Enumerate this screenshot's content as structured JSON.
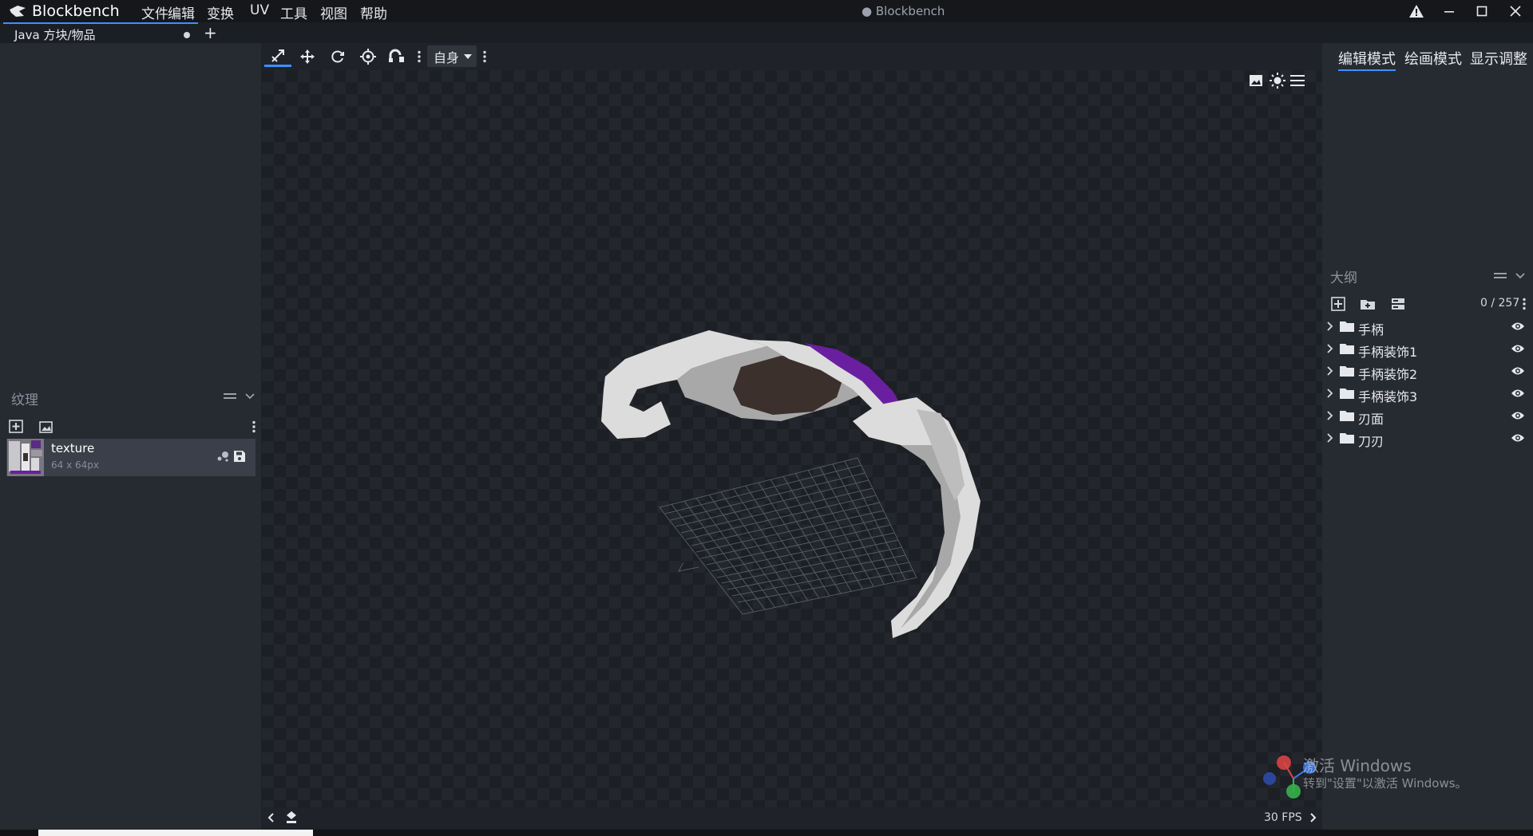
{
  "app": {
    "name": "Blockbench",
    "window_title": "● Blockbench",
    "menu": [
      "文件",
      "编辑",
      "变换",
      "UV",
      "工具",
      "视图",
      "帮助"
    ]
  },
  "tabs": [
    {
      "label": "Java 方块/物品",
      "unsaved": true
    }
  ],
  "toolbar": {
    "transform_space": "自身"
  },
  "modes": [
    "编辑模式",
    "绘画模式",
    "显示调整"
  ],
  "textures_panel": {
    "title": "纹理",
    "items": [
      {
        "name": "texture",
        "size": "64 x 64px"
      }
    ]
  },
  "outliner": {
    "title": "大纲",
    "count": "0 / 257",
    "groups": [
      "手柄",
      "手柄装饰1",
      "手柄装饰2",
      "手柄装饰3",
      "刃面",
      "刀刃"
    ]
  },
  "viewport": {
    "fps": "30 FPS"
  },
  "watermark": {
    "line1": "激活 Windows",
    "line2": "转到\"设置\"以激活 Windows。"
  },
  "colors": {
    "accent": "#3e90ff",
    "blade_light": "#dcdcdc",
    "blade_mid": "#a8a8a8",
    "blade_purple": "#6a1fa0",
    "blade_dark": "#3b302c"
  }
}
